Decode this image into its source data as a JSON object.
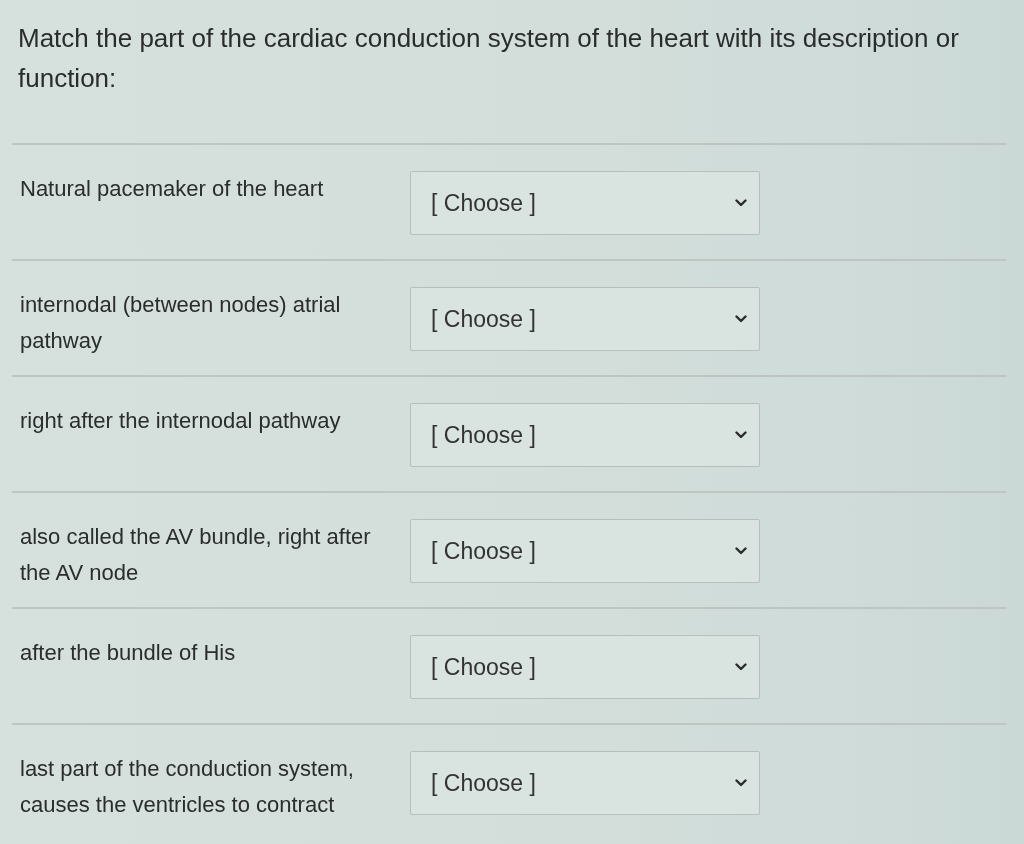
{
  "question": "Match the part of the cardiac conduction system of the heart with its description or function:",
  "items": [
    {
      "description": "Natural pacemaker of the heart",
      "choice": "[ Choose ]"
    },
    {
      "description": "internodal (between nodes) atrial pathway",
      "choice": "[ Choose ]"
    },
    {
      "description": "right after the internodal pathway",
      "choice": "[ Choose ]"
    },
    {
      "description": "also called the AV bundle, right after the AV node",
      "choice": "[ Choose ]"
    },
    {
      "description": "after the bundle of His",
      "choice": "[ Choose ]"
    },
    {
      "description": "last part of the conduction system, causes the ventricles to contract",
      "choice": "[ Choose ]"
    }
  ]
}
